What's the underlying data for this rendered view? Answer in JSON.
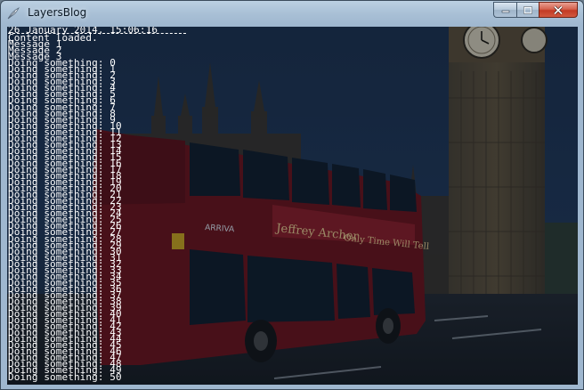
{
  "window": {
    "title": "LayersBlog",
    "icons": {
      "app": "feather-icon",
      "minimize": "minimize-icon",
      "maximize": "maximize-icon",
      "close": "close-icon"
    }
  },
  "scene": {
    "bus_ad_text": "Jeffrey Archer",
    "bus_ad_text2": "Only Time Will Tell",
    "bus_brand": "ARRIVA"
  },
  "console": {
    "header": "26 January 2014, 15:06:16",
    "lines": [
      "Content loaded.",
      "Message 1",
      "Message 2",
      "Message 3",
      "Doing something: 0",
      "Doing something: 1",
      "Doing something: 2",
      "Doing something: 3",
      "Doing something: 4",
      "Doing something: 5",
      "Doing something: 6",
      "Doing something: 7",
      "Doing something: 8",
      "Doing something: 9",
      "Doing something: 10",
      "Doing something: 11",
      "Doing something: 12",
      "Doing something: 13",
      "Doing something: 14",
      "Doing something: 15",
      "Doing something: 16",
      "Doing something: 17",
      "Doing something: 18",
      "Doing something: 19",
      "Doing something: 20",
      "Doing something: 21",
      "Doing something: 22",
      "Doing something: 23",
      "Doing something: 24",
      "Doing something: 25",
      "Doing something: 26",
      "Doing something: 27",
      "Doing something: 28",
      "Doing something: 29",
      "Doing something: 30",
      "Doing something: 31",
      "Doing something: 32",
      "Doing something: 33",
      "Doing something: 34",
      "Doing something: 35",
      "Doing something: 36",
      "Doing something: 37",
      "Doing something: 38",
      "Doing something: 39",
      "Doing something: 40",
      "Doing something: 41",
      "Doing something: 42",
      "Doing something: 43",
      "Doing something: 44",
      "Doing something: 45",
      "Doing something: 46",
      "Doing something: 47",
      "Doing something: 48",
      "Doing something: 49",
      "Doing something: 50"
    ]
  }
}
